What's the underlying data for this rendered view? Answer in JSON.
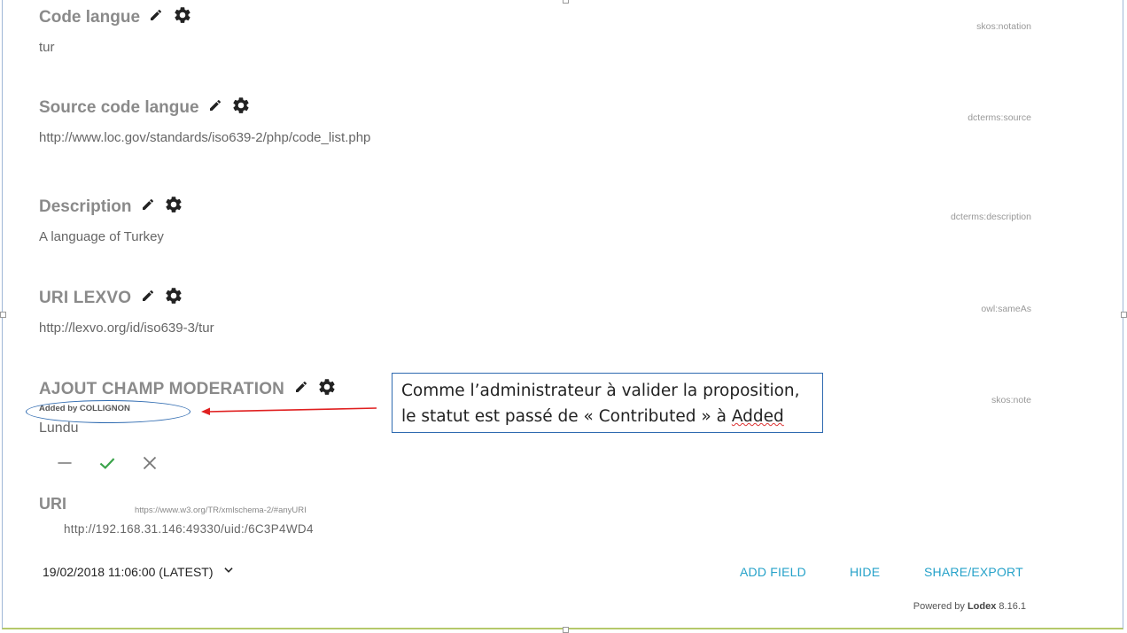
{
  "fields": [
    {
      "title": "Code langue",
      "value": "tur",
      "predicate": "skos:notation"
    },
    {
      "title": "Source code langue",
      "value": "http://www.loc.gov/standards/iso639-2/php/code_list.php",
      "predicate": "dcterms:source"
    },
    {
      "title": "Description",
      "value": "A language of Turkey",
      "predicate": "dcterms:description"
    },
    {
      "title": "URI LEXVO",
      "value": "http://lexvo.org/id/iso639-3/tur",
      "predicate": "owl:sameAs"
    }
  ],
  "moderation": {
    "title": "AJOUT CHAMP MODERATION",
    "status": "Added by COLLIGNON",
    "value": "Lundu",
    "predicate": "skos:note",
    "actions": [
      "minus-icon",
      "check-icon",
      "close-icon"
    ]
  },
  "annotation": {
    "line1": "Comme l’administrateur à valider la proposition,",
    "line2_prefix": "le statut est passé de « Contributed » à ",
    "line2_word": "Added"
  },
  "uri": {
    "label": "URI",
    "type": "https://www.w3.org/TR/xmlschema-2/#anyURI",
    "value": "http://192.168.31.146:49330/uid:/6C3P4WD4"
  },
  "footer": {
    "version": "19/02/2018 11:06:00 (LATEST)",
    "add_field": "ADD FIELD",
    "hide": "HIDE",
    "share_export": "SHARE/EXPORT",
    "powered_prefix": "Powered by",
    "powered_brand": "Lodex",
    "powered_version": "8.16.1"
  },
  "colors": {
    "accent": "#26a2c9",
    "check": "#3aa34a",
    "annotation": "#2e6ab0",
    "arrow": "#e02020"
  }
}
